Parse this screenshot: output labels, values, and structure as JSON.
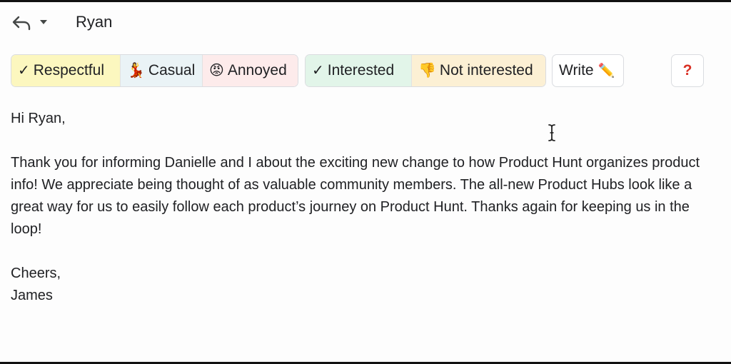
{
  "header": {
    "recipient": "Ryan",
    "reply_icon": "reply-arrow-icon",
    "dropdown_icon": "caret-down-icon"
  },
  "toolbar": {
    "tone_group": [
      {
        "icon": "✓",
        "label": "Respectful"
      },
      {
        "icon": "💃",
        "label": "Casual"
      },
      {
        "icon": "😡",
        "label": "Annoyed"
      }
    ],
    "interest_group": [
      {
        "icon": "✓",
        "label": "Interested"
      },
      {
        "icon": "👎",
        "label": "Not interested"
      }
    ],
    "write": {
      "label": "Write",
      "icon": "✏️"
    },
    "help": {
      "label": "?"
    }
  },
  "message": {
    "greeting": "Hi Ryan,",
    "paragraph": "Thank you for informing Danielle and I about the exciting new change to how Product Hunt organizes product info! We appreciate being thought of as valuable community members. The all-new Product Hubs look like a great way for us to easily follow each product’s journey on Product Hunt. Thanks again for keeping us in the loop!",
    "signoff": "Cheers,",
    "signature": "James"
  },
  "colors": {
    "respectful_bg": "#fcf7bf",
    "casual_bg": "#eaf3f6",
    "annoyed_bg": "#fdebeb",
    "interested_bg": "#e2f5e9",
    "not_interested_bg": "#fcf0d4",
    "help_accent": "#d93025"
  }
}
